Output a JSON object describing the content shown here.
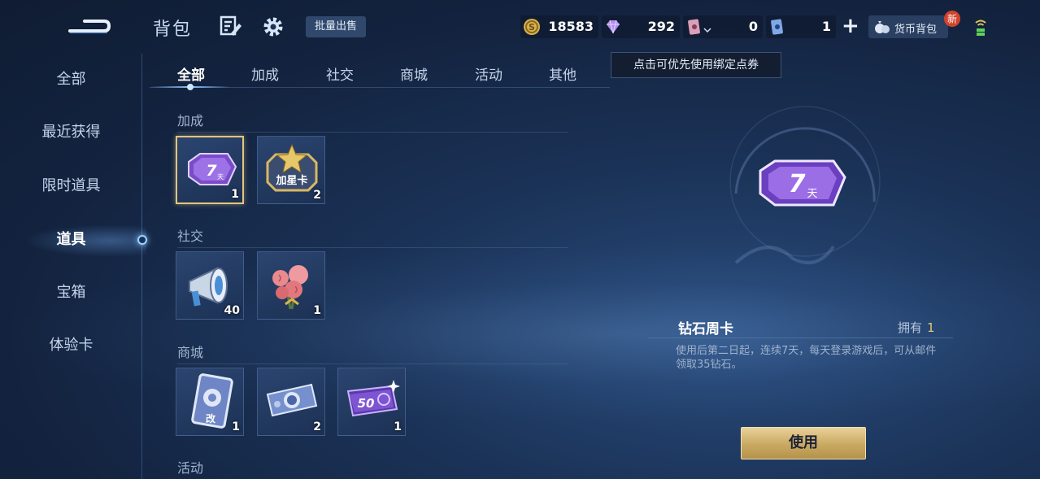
{
  "header": {
    "title": "背包",
    "bulk_sell_label": "批量出售",
    "currencies": [
      {
        "name": "gold-coin",
        "value": "18583"
      },
      {
        "name": "diamond",
        "value": "292"
      },
      {
        "name": "bound-voucher",
        "value": "0"
      },
      {
        "name": "voucher",
        "value": "1"
      }
    ],
    "wallet_label": "货币背包",
    "new_badge": "新"
  },
  "tooltip": "点击可优先使用绑定点券",
  "sidebar": {
    "items": [
      {
        "label": "全部"
      },
      {
        "label": "最近获得"
      },
      {
        "label": "限时道具"
      },
      {
        "label": "道具",
        "active": true
      },
      {
        "label": "宝箱"
      },
      {
        "label": "体验卡"
      }
    ]
  },
  "tabs": [
    {
      "label": "全部",
      "active": true
    },
    {
      "label": "加成"
    },
    {
      "label": "社交"
    },
    {
      "label": "商城"
    },
    {
      "label": "活动"
    },
    {
      "label": "其他"
    }
  ],
  "sections": [
    {
      "label": "加成",
      "items": [
        {
          "icon": "diamond-week-card-icon",
          "count": "1",
          "selected": true
        },
        {
          "icon": "add-star-card-icon",
          "count": "2",
          "text": "加星卡"
        }
      ]
    },
    {
      "label": "社交",
      "items": [
        {
          "icon": "megaphone-icon",
          "count": "40"
        },
        {
          "icon": "rose-bouquet-icon",
          "count": "1"
        }
      ]
    },
    {
      "label": "商城",
      "items": [
        {
          "icon": "rename-card-icon",
          "count": "1",
          "text": "改"
        },
        {
          "icon": "coupon-ticket-icon",
          "count": "2"
        },
        {
          "icon": "fifty-coupon-icon",
          "count": "1",
          "text": "50"
        }
      ]
    },
    {
      "label": "活动",
      "items": []
    }
  ],
  "detail": {
    "name": "钻石周卡",
    "own_label": "拥有",
    "own_count": "1",
    "description": "使用后第二日起，连续7天，每天登录游戏后，可从邮件领取35钻石。",
    "use_button": "使用",
    "card_text": "7",
    "card_sub": "天"
  },
  "colors": {
    "accent_gold": "#e2c57d",
    "card_purple": "#8a5cd6",
    "panel_blue": "#1c3154"
  }
}
